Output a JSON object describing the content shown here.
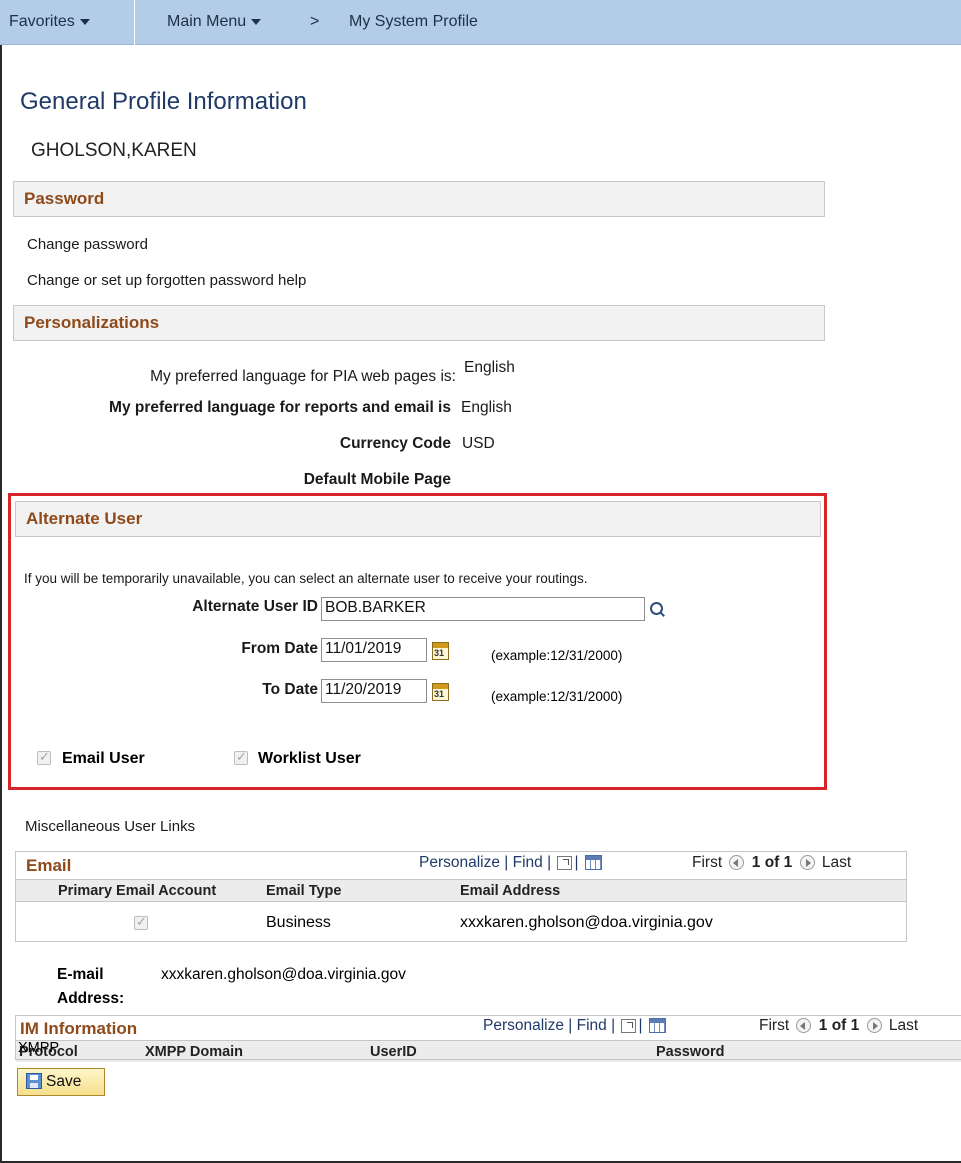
{
  "nav": {
    "favorites": "Favorites",
    "main_menu": "Main Menu",
    "breadcrumb_sep": ">",
    "current_page": "My System Profile"
  },
  "page": {
    "title": "General Profile Information",
    "person_name": "GHOLSON,KAREN"
  },
  "password": {
    "header": "Password",
    "change_link": "Change password",
    "help_link": "Change or set up forgotten password help"
  },
  "personalizations": {
    "header": "Personalizations",
    "pia_language_label": "My preferred language for PIA web pages is:",
    "pia_language_value": "English",
    "report_language_label": "My preferred language for reports and email is",
    "report_language_value": "English",
    "currency_label": "Currency Code",
    "currency_value": "USD",
    "mobile_label": "Default Mobile Page",
    "mobile_value": ""
  },
  "alternate_user": {
    "header": "Alternate User",
    "instructions": "If you will be temporarily unavailable, you can select an alternate user to receive your routings.",
    "user_id_label": "Alternate User ID",
    "user_id_value": "BOB.BARKER",
    "from_date_label": "From Date",
    "from_date_value": "11/01/2019",
    "to_date_label": "To Date",
    "to_date_value": "11/20/2019",
    "date_example": "(example:12/31/2000)",
    "calendar_glyph": "31",
    "email_user_label": "Email User",
    "email_user_checked": true,
    "worklist_user_label": "Worklist User",
    "worklist_user_checked": true
  },
  "misc_links_label": "Miscellaneous User Links",
  "email_grid": {
    "title": "Email",
    "personalize": "Personalize",
    "find": "Find",
    "first": "First",
    "pager": "1 of 1",
    "last": "Last",
    "columns": [
      "Primary Email Account",
      "Email Type",
      "Email Address"
    ],
    "rows": [
      {
        "primary": true,
        "type": "Business",
        "address": "xxxkaren.gholson@doa.virginia.gov"
      }
    ]
  },
  "email_address": {
    "label_line1": "E-mail",
    "label_line2": "Address:",
    "value": "xxxkaren.gholson@doa.virginia.gov"
  },
  "im_grid": {
    "title": "IM Information",
    "personalize": "Personalize",
    "find": "Find",
    "first": "First",
    "pager": "1 of 1",
    "last": "Last",
    "columns": [
      "Protocol",
      "XMPP Domain",
      "UserID",
      "Password"
    ],
    "rows": [
      {
        "protocol": "XMPP",
        "domain": "",
        "user_id": "",
        "password": ""
      }
    ]
  },
  "save_button": "Save",
  "colors": {
    "nav_bg": "#b3cde8",
    "section_title": "#8e4a1b",
    "page_title": "#1f3a67",
    "highlight_border": "#d7262b"
  }
}
